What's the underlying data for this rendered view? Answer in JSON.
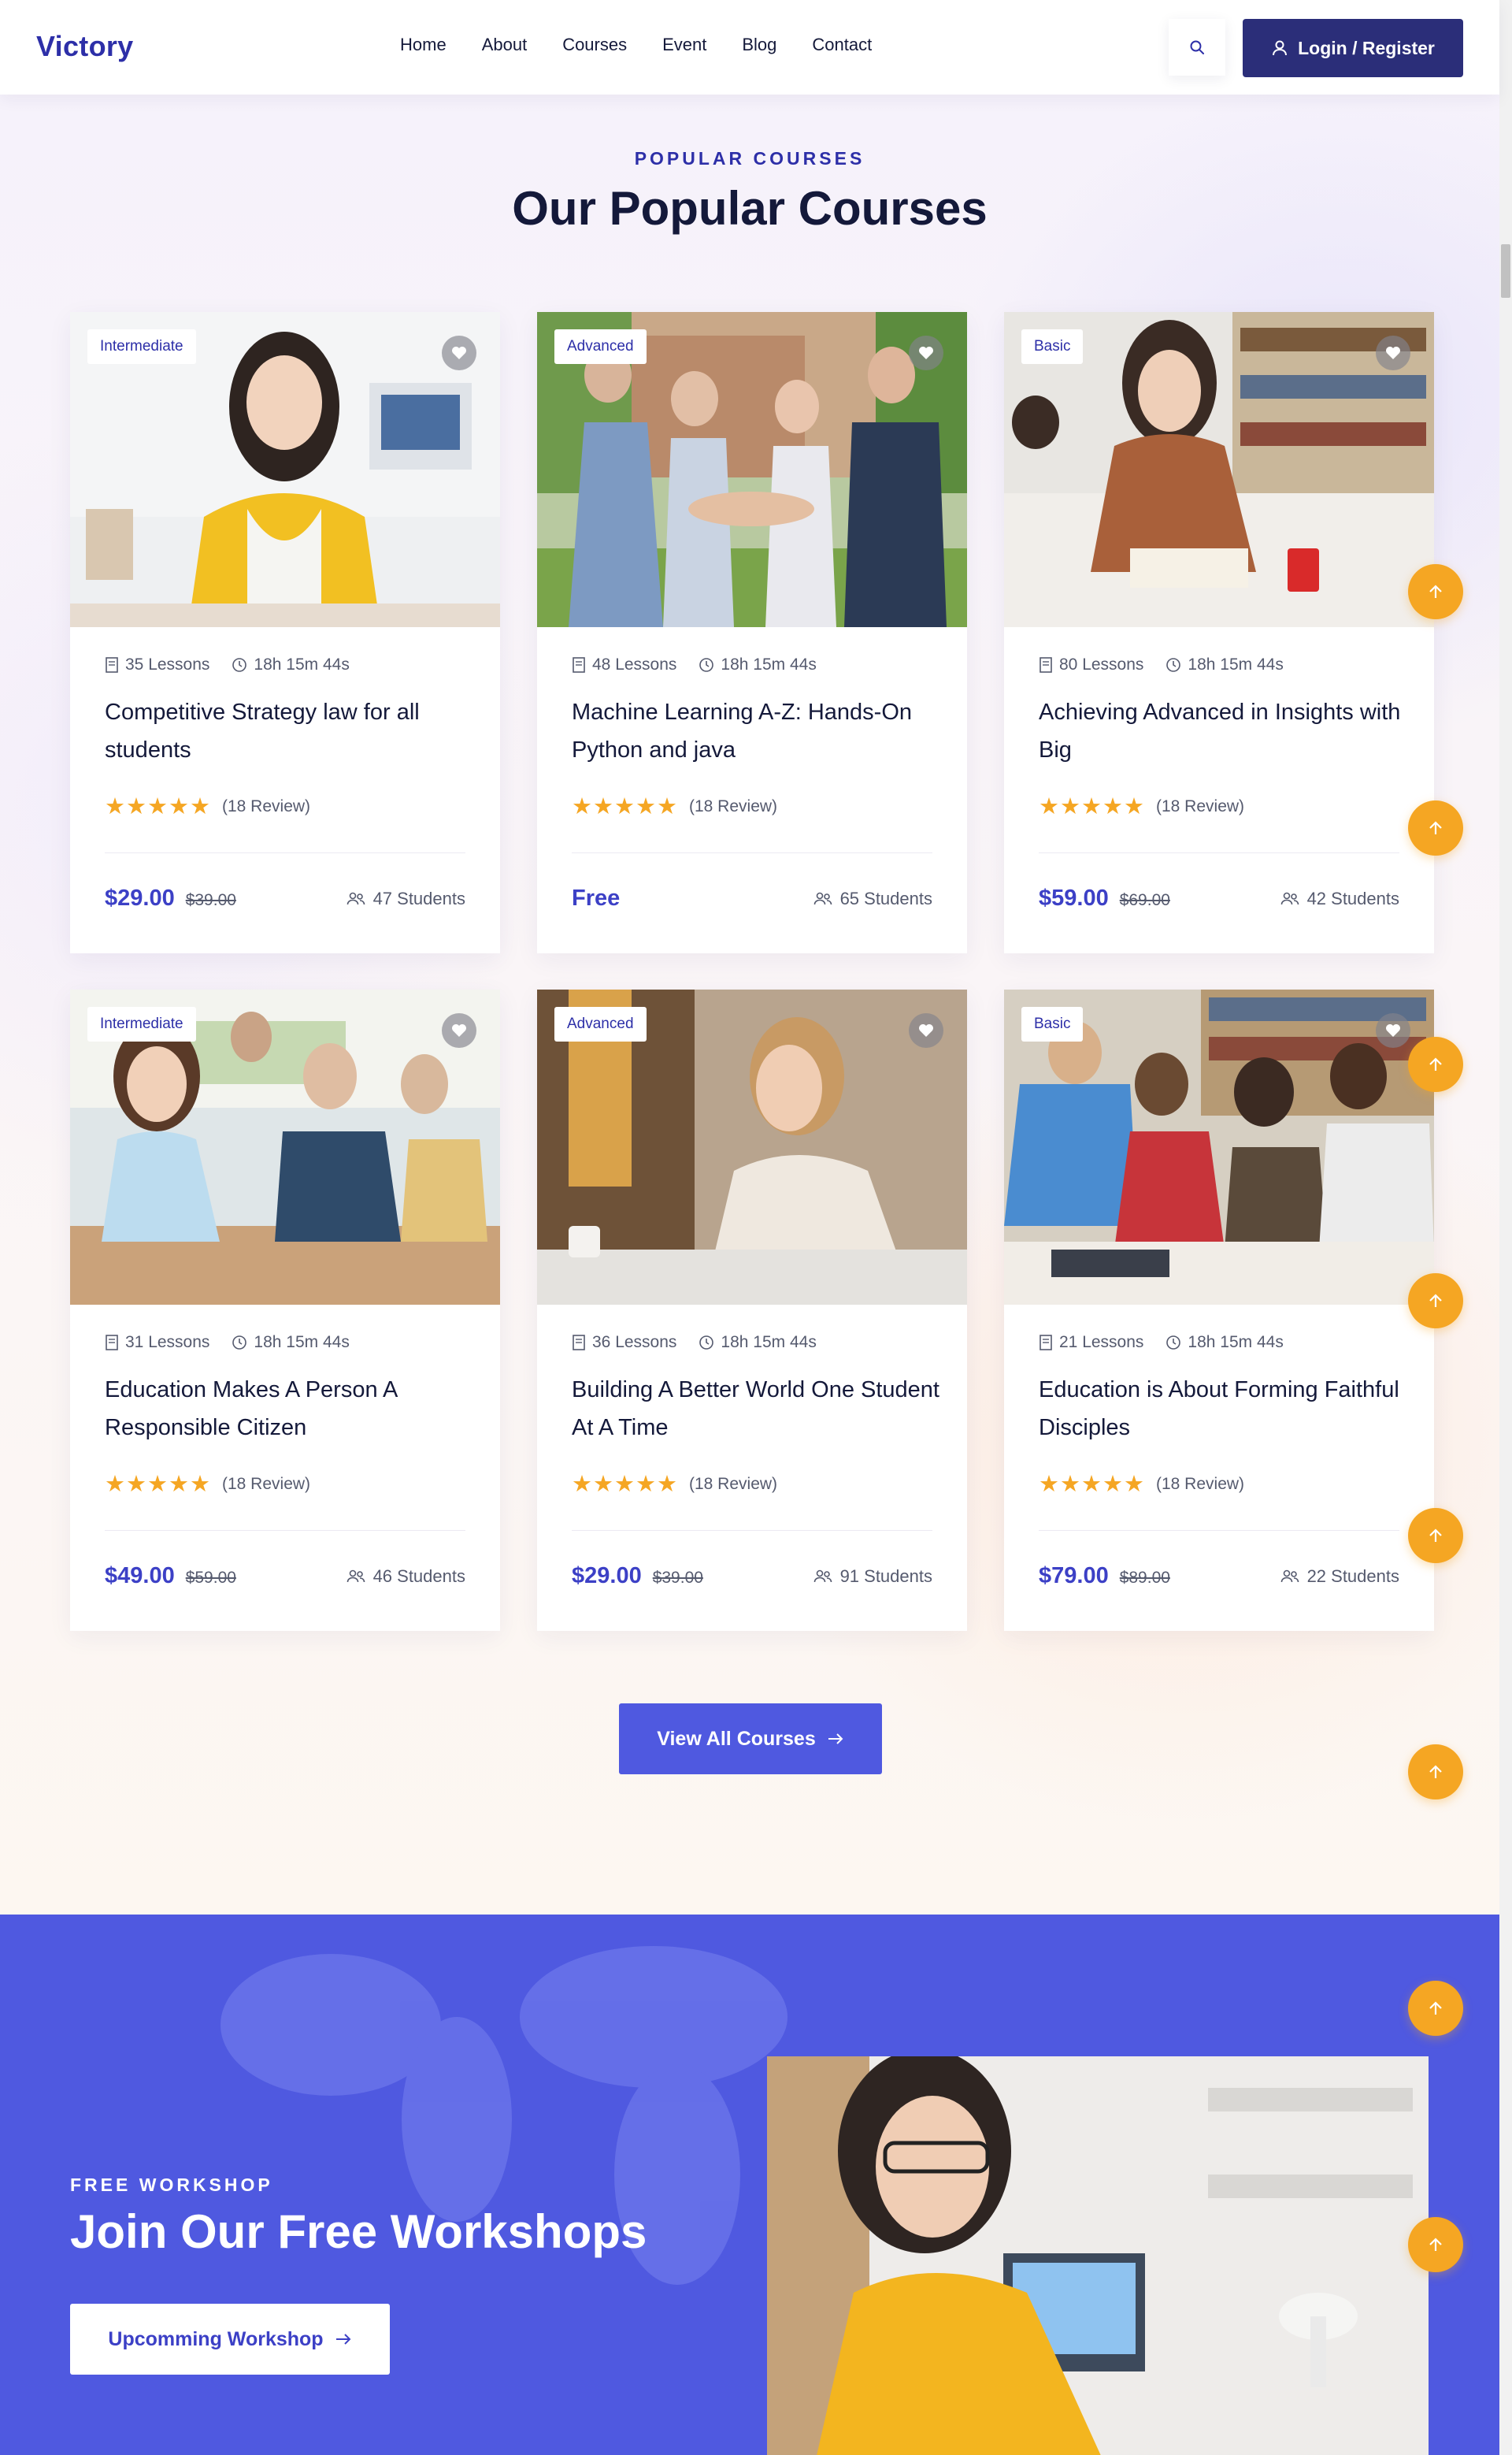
{
  "header": {
    "logo": "Victory",
    "nav": [
      "Home",
      "About",
      "Courses",
      "Event",
      "Blog",
      "Contact"
    ],
    "login_label": "Login / Register"
  },
  "courses": {
    "tag": "POPULAR COURSES",
    "title": "Our Popular Courses",
    "cards": [
      {
        "level": "Intermediate",
        "lessons": "35 Lessons",
        "duration": "18h 15m 44s",
        "title": "Competitive Strategy law for all students",
        "stars": "★★★★★",
        "review": "(18 Review)",
        "price": "$29.00",
        "old_price": "$39.00",
        "students": "47 Students"
      },
      {
        "level": "Advanced",
        "lessons": "48 Lessons",
        "duration": "18h 15m 44s",
        "title": "Machine Learning A-Z: Hands-On Python and java",
        "stars": "★★★★★",
        "review": "(18 Review)",
        "price": "Free",
        "old_price": "",
        "students": "65 Students"
      },
      {
        "level": "Basic",
        "lessons": "80 Lessons",
        "duration": "18h 15m 44s",
        "title": "Achieving Advanced in Insights with Big",
        "stars": "★★★★★",
        "review": "(18 Review)",
        "price": "$59.00",
        "old_price": "$69.00",
        "students": "42 Students"
      },
      {
        "level": "Intermediate",
        "lessons": "31 Lessons",
        "duration": "18h 15m 44s",
        "title": "Education Makes A Person A Responsible Citizen",
        "stars": "★★★★★",
        "review": "(18 Review)",
        "price": "$49.00",
        "old_price": "$59.00",
        "students": "46 Students"
      },
      {
        "level": "Advanced",
        "lessons": "36 Lessons",
        "duration": "18h 15m 44s",
        "title": "Building A Better World One Student At A Time",
        "stars": "★★★★★",
        "review": "(18 Review)",
        "price": "$29.00",
        "old_price": "$39.00",
        "students": "91 Students"
      },
      {
        "level": "Basic",
        "lessons": "21 Lessons",
        "duration": "18h 15m 44s",
        "title": "Education is About Forming Faithful Disciples",
        "stars": "★★★★★",
        "review": "(18 Review)",
        "price": "$79.00",
        "old_price": "$89.00",
        "students": "22 Students"
      }
    ],
    "view_all_label": "View All Courses"
  },
  "workshop": {
    "tag": "FREE WORKSHOP",
    "title": "Join Our Free Workshops",
    "button_label": "Upcomming Workshop"
  },
  "icons": {
    "search": "search-icon",
    "user": "user-icon",
    "heart": "heart-icon",
    "lessons": "document-icon",
    "duration": "clock-icon",
    "students": "users-icon",
    "arrow": "arrow-right-icon",
    "scroll_top": "arrow-up-icon"
  },
  "colors": {
    "brand_dark": "#2b2e79",
    "brand": "#4f59e0",
    "price": "#3c40c6",
    "star": "#f5a623",
    "scroll_top": "#f5a623"
  }
}
